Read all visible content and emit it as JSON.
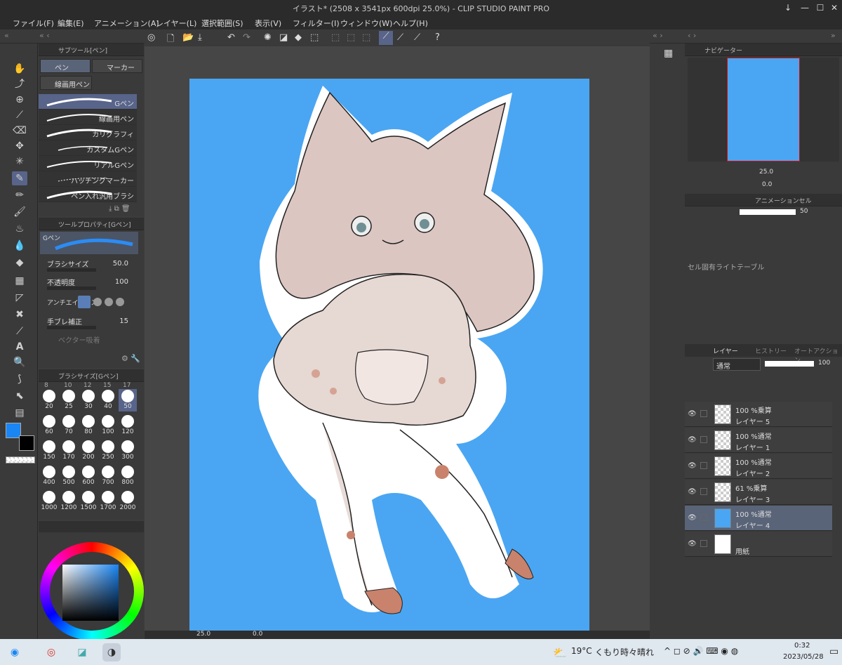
{
  "window": {
    "title": "イラスト* (2508 x 3541px 600dpi 25.0%) - CLIP STUDIO PAINT PRO"
  },
  "menu": [
    "ファイル(F)",
    "編集(E)",
    "アニメーション(A)",
    "レイヤー(L)",
    "選択範囲(S)",
    "表示(V)",
    "フィルター(I)",
    "ウィンドウ(W)",
    "ヘルプ(H)"
  ],
  "subtool": {
    "header": "サブツール[ペン]",
    "tabs": [
      "ペン",
      "マーカー",
      "線画用ペン"
    ],
    "brushes": [
      "Gペン",
      "線画用ペン",
      "カリグラフィ",
      "カスタムGペン",
      "リアルGペン",
      "ハッチングマーカー",
      "ペン入れ汎用ブラシ"
    ]
  },
  "toolprop": {
    "header": "ツールプロパティ[Gペン]",
    "preview_label": "Gペン",
    "brush_size_label": "ブラシサイズ",
    "brush_size": "50.0",
    "opacity_label": "不透明度",
    "opacity": "100",
    "antialias_label": "アンチエイリアス",
    "stabilization_label": "手ブレ補正",
    "stabilization": "15",
    "vector_label": "ベクター吸着"
  },
  "brushsize": {
    "header": "ブラシサイズ[Gペン]",
    "top_row": [
      "8",
      "10",
      "12",
      "15",
      "17"
    ],
    "sizes": [
      "20",
      "25",
      "30",
      "40",
      "50",
      "60",
      "70",
      "80",
      "100",
      "120",
      "150",
      "170",
      "200",
      "250",
      "300",
      "400",
      "500",
      "600",
      "700",
      "800",
      "1000",
      "1200",
      "1500",
      "1700",
      "2000"
    ],
    "selected": "50"
  },
  "colors": {
    "main": "#1a86f4",
    "sub": "#000000",
    "canvas_bg": "#4aa6f2"
  },
  "navigator": {
    "header": "ナビゲーター",
    "zoom": "25.0",
    "rotate": "0.0"
  },
  "animation": {
    "header": "アニメーションセル",
    "value": "50",
    "lighttable_label": "セル固有ライトテーブル"
  },
  "layers": {
    "tabs": [
      "レイヤー",
      "ヒストリー",
      "オートアクション"
    ],
    "blend_mode": "通常",
    "opacity": "100",
    "items": [
      {
        "mode": "100 %乗算",
        "name": "レイヤー 5"
      },
      {
        "mode": "100 %通常",
        "name": "レイヤー 1"
      },
      {
        "mode": "100 %通常",
        "name": "レイヤー 2"
      },
      {
        "mode": "61 %乗算",
        "name": "レイヤー 3"
      },
      {
        "mode": "100 %通常",
        "name": "レイヤー 4"
      },
      {
        "mode": "",
        "name": "用紙"
      }
    ]
  },
  "canvas_status": {
    "zoom": "25.0",
    "angle": "0.0"
  },
  "taskbar": {
    "weather_temp": "19°C",
    "weather_text": "くもり時々晴れ",
    "time": "0:32",
    "date": "2023/05/28"
  }
}
